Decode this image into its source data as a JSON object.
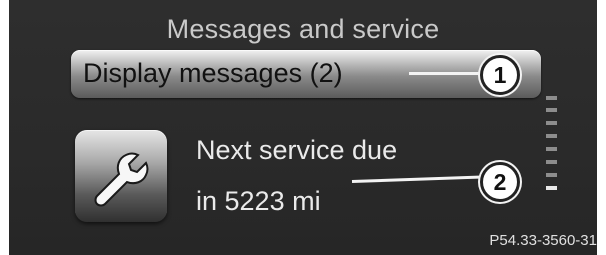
{
  "screen": {
    "title": "Messages and service"
  },
  "menu": {
    "display_messages_label": "Display messages (2)"
  },
  "service": {
    "icon": "wrench-icon",
    "line1": "Next service due",
    "line2": "in 5223 mi"
  },
  "callouts": {
    "first": "1",
    "second": "2"
  },
  "reference_code": "P54.33-3560-31",
  "scrollbar": {
    "tick_count": 8,
    "active_tick": 8
  },
  "colors": {
    "background": "#2e2e2e",
    "highlight": "#cfcfcf",
    "text": "#eaeaea",
    "title_text": "#c9c9c9"
  }
}
